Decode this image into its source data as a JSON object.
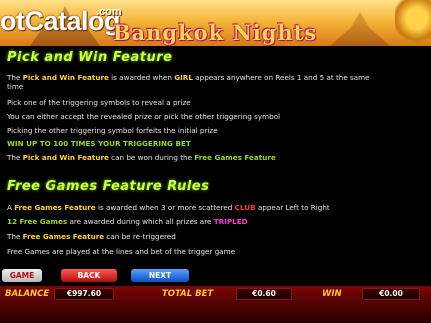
{
  "header": {
    "logo_text": "otCatalog",
    "logo_suffix": ".com",
    "game_title": "Bangkok Nights"
  },
  "pick_and_win": {
    "title": "Pick and Win Feature",
    "line1_part1": "The ",
    "line1_hl1": "Pick and Win Feature",
    "line1_part2": " is awarded when ",
    "line1_hl2": "GIRL",
    "line1_part3": " appears anywhere on Reels 1 and 5 at the same",
    "line1_cont": "time",
    "line2": "Pick one of the triggering symbols to reveal a prize",
    "line3": "You can either accept the revealed prize or pick the other triggering symbol",
    "line4": "Picking the other triggering symbol forfeits the initial prize",
    "line5": "WIN UP TO 100 TIMES YOUR TRIGGERING BET",
    "line6_part1": "The ",
    "line6_hl1": "Pick and Win Feature",
    "line6_part2": " can be won during the ",
    "line6_hl2": "Free Games Feature"
  },
  "free_games": {
    "title": "Free Games Feature Rules",
    "line1_part1": "A ",
    "line1_hl1": "Free Games Feature",
    "line1_part2": " is awarded when 3 or more scattered ",
    "line1_hl2": "CLUB",
    "line1_part3": " appear Left to Right",
    "line2_hl1": "12 Free Games",
    "line2_part1": " are awarded during which all prizes are ",
    "line2_hl2": "TRIPLED",
    "line3_part1": "The ",
    "line3_hl1": "Free Games Feature",
    "line3_part2": " can be re-triggered",
    "line4": "Free Games are played at the lines and bet of the trigger game"
  },
  "controls": {
    "game_label": "GAME",
    "back_label": "BACK",
    "next_label": "NEXT"
  },
  "status": {
    "balance_label": "BALANCE",
    "balance_value": "€997.60",
    "total_bet_label": "TOTAL BET",
    "total_bet_value": "€0.60",
    "win_label": "WIN",
    "win_value": "€0.00"
  }
}
